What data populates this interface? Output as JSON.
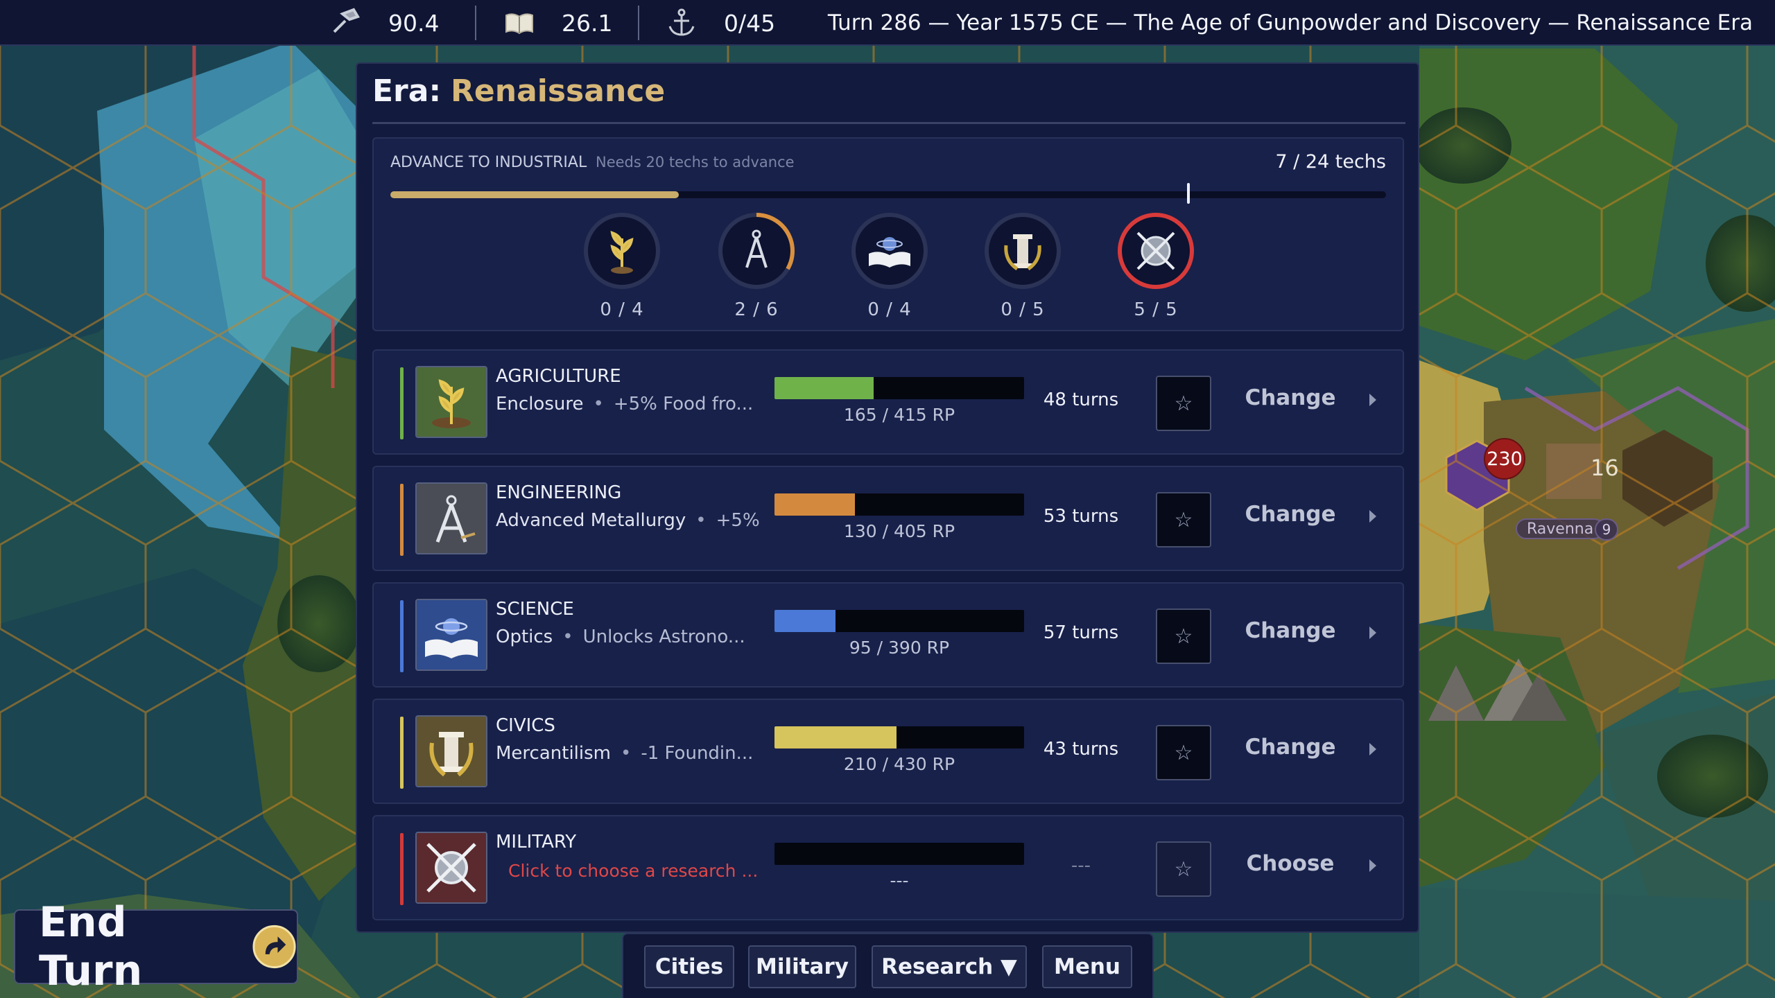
{
  "topbar": {
    "gold": {
      "icon": "hammer-icon",
      "value": "90.4"
    },
    "science": {
      "icon": "book-icon",
      "value": "26.1"
    },
    "naval": {
      "icon": "anchor-icon",
      "value": "0/45"
    },
    "turn_info": "Turn 286 — Year 1575 CE — The Age of Gunpowder and Discovery — Renaissance Era"
  },
  "era": {
    "label": "Era:",
    "name": "Renaissance",
    "advance": {
      "heading": "ADVANCE TO INDUSTRIAL",
      "subheading": "Needs 20 techs to advance",
      "count": "7 / 24 techs",
      "progress": 0.29,
      "threshold": 0.8
    },
    "categories": [
      {
        "icon": "wheat-icon",
        "count": "0 / 4",
        "progress": 0,
        "color": "#8fbf5a"
      },
      {
        "icon": "compass-icon",
        "count": "2 / 6",
        "progress": 0.333,
        "color": "#d9903e"
      },
      {
        "icon": "planet-book-icon",
        "count": "0 / 4",
        "progress": 0,
        "color": "#5a86d8"
      },
      {
        "icon": "pillar-icon",
        "count": "0 / 5",
        "progress": 0,
        "color": "#d9c25a"
      },
      {
        "icon": "sword-shield-icon",
        "count": "5 / 5",
        "progress": 1,
        "color": "#d83a3a"
      }
    ]
  },
  "research_rows": [
    {
      "category": "AGRICULTURE",
      "tech": "Enclosure",
      "effect": "+5% Food fro...",
      "rp": "165 / 415 RP",
      "progress": 0.3976,
      "turns": "48 turns",
      "action": "Change",
      "color": "#6fb24a",
      "icon": "wheat-icon"
    },
    {
      "category": "ENGINEERING",
      "tech": "Advanced Metallurgy",
      "effect": "+5%",
      "rp": "130 / 405 RP",
      "progress": 0.321,
      "turns": "53 turns",
      "action": "Change",
      "color": "#d48a3e",
      "icon": "compass-icon"
    },
    {
      "category": "SCIENCE",
      "tech": "Optics",
      "effect": "Unlocks Astrono...",
      "rp": "95 / 390 RP",
      "progress": 0.2436,
      "turns": "57 turns",
      "action": "Change",
      "color": "#4a79d8",
      "icon": "planet-book-icon"
    },
    {
      "category": "CIVICS",
      "tech": "Mercantilism",
      "effect": "-1 Foundin...",
      "rp": "210 / 430 RP",
      "progress": 0.4884,
      "turns": "43 turns",
      "action": "Change",
      "color": "#d6c45c",
      "icon": "pillar-icon"
    },
    {
      "category": "MILITARY",
      "tech": "Click to choose a research ...",
      "effect": "",
      "rp": "---",
      "progress": 0,
      "turns": "---",
      "action": "Choose",
      "color": "#d33a3a",
      "icon": "sword-shield-icon"
    }
  ],
  "star_glyph": "☆",
  "bottom_nav": {
    "cities": "Cities",
    "military": "Military",
    "research": "Research ▼",
    "menu": "Menu"
  },
  "end_turn": {
    "label": "End Turn",
    "icon": "turn-arrow-icon"
  },
  "map": {
    "city_name": "Ravenna",
    "city_number": "9",
    "unit_strength": "230",
    "population": "16"
  }
}
